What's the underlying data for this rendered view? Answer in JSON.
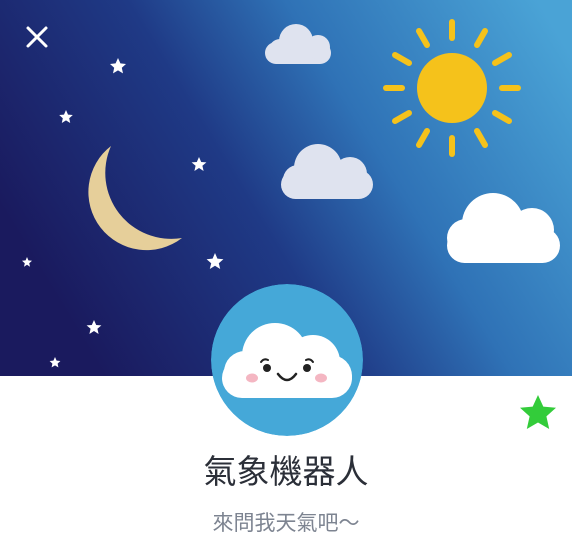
{
  "profile": {
    "name": "氣象機器人",
    "status_message": "來問我天氣吧〜"
  },
  "icons": {
    "close": "close-icon",
    "favorite": "star-icon",
    "avatar": "cloud-face-icon",
    "cover": [
      "moon-icon",
      "sun-icon",
      "cloud-icon",
      "star-icon"
    ]
  },
  "colors": {
    "night": "#1a1a5e",
    "day": "#4aa3d6",
    "sun": "#f5c21b",
    "moon": "#e6cf9a",
    "avatar_bg": "#45a8d8",
    "favorite_star": "#33cc3a",
    "name_text": "#2b2f38",
    "status_text": "#7d8491"
  }
}
